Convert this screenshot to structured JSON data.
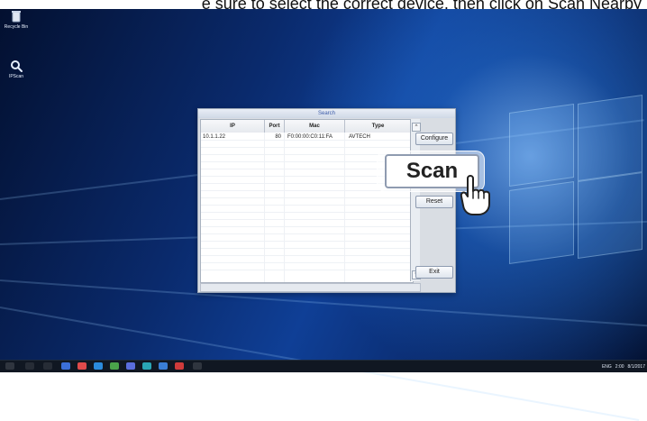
{
  "top_banner": {
    "text": "e sure to select the correct device, then click on Scan Nearby"
  },
  "desktop": {
    "icons": [
      {
        "label": "Recycle Bin",
        "icon": "recycle-bin-icon"
      },
      {
        "label": "IPScan",
        "icon": "search-app-icon"
      }
    ]
  },
  "app": {
    "title": "Search",
    "columns": [
      "IP",
      "Port",
      "Mac",
      "Type"
    ],
    "rows": [
      {
        "ip": "10.1.1.22",
        "port": "80",
        "mac": "F0:00:00:C0:11:FA",
        "type": "AVTECH"
      }
    ],
    "buttons": {
      "configure": "Configure",
      "reset": "Reset",
      "exit": "Exit"
    },
    "scroll_up_glyph": "^",
    "scroll_down_glyph": "v"
  },
  "callout": {
    "scan_label": "Scan"
  },
  "taskbar": {
    "items": [
      "start-icon",
      "search-icon",
      "task-view-icon",
      "file-explorer-icon",
      "edge-icon",
      "ie-icon",
      "store-icon",
      "mail-icon",
      "app-icon",
      "photos-icon",
      "app-icon-2",
      "app-icon-3"
    ],
    "tray": {
      "lang": "ENG",
      "time": "2:00",
      "date": "8/1/2017"
    }
  }
}
